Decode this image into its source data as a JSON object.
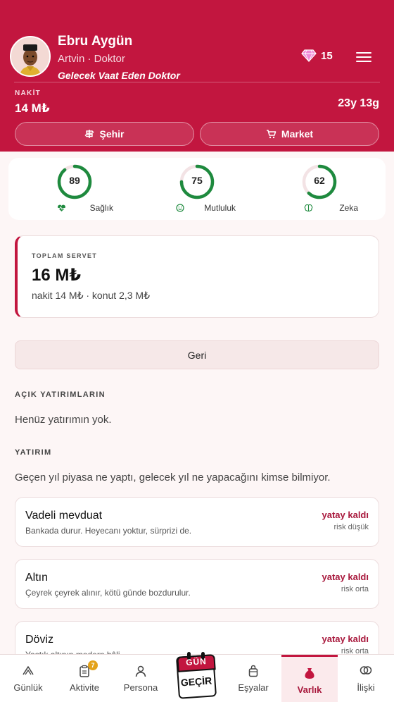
{
  "header": {
    "name": "Ebru Aygün",
    "location": "Artvin · Doktor",
    "motto": "Gelecek Vaat Eden Doktor",
    "gems": "15",
    "cash_label": "NAKİT",
    "cash_value": "14 M₺",
    "age": "23y 13g",
    "city_button": "Şehir",
    "market_button": "Market"
  },
  "stats": [
    {
      "value": 89,
      "label": "Sağlık"
    },
    {
      "value": 75,
      "label": "Mutluluk"
    },
    {
      "value": 62,
      "label": "Zeka"
    }
  ],
  "wealth": {
    "label": "TOPLAM SERVET",
    "value": "16 M₺",
    "breakdown": "nakit 14 M₺ · konut 2,3 M₺"
  },
  "back_button": "Geri",
  "open_investments": {
    "title": "AÇIK YATIRIMLARIN",
    "empty_text": "Henüz yatırımın yok."
  },
  "investment": {
    "title": "YATIRIM",
    "intro": "Geçen yıl piyasa ne yaptı, gelecek yıl ne yapacağını kimse bilmiyor.",
    "items": [
      {
        "name": "Vadeli mevduat",
        "desc": "Bankada durur. Heyecanı yoktur, sürprizi de.",
        "status": "yatay kaldı",
        "risk": "risk düşük"
      },
      {
        "name": "Altın",
        "desc": "Çeyrek çeyrek alınır, kötü günde bozdurulur.",
        "status": "yatay kaldı",
        "risk": "risk orta"
      },
      {
        "name": "Döviz",
        "desc": "Yastık altının modern hâli.",
        "status": "yatay kaldı",
        "risk": "risk orta"
      }
    ]
  },
  "nav": {
    "items": [
      "Günlük",
      "Aktivite",
      "Persona",
      "Eşyalar",
      "Varlık",
      "İlişki"
    ],
    "activity_badge": "7",
    "gun_top": "GÜN",
    "gun_bottom": "GEÇİR",
    "active": "Varlık"
  },
  "colors": {
    "primary": "#c2163f",
    "ring_good": "#1e8a3e",
    "status_text": "#a8183c"
  }
}
